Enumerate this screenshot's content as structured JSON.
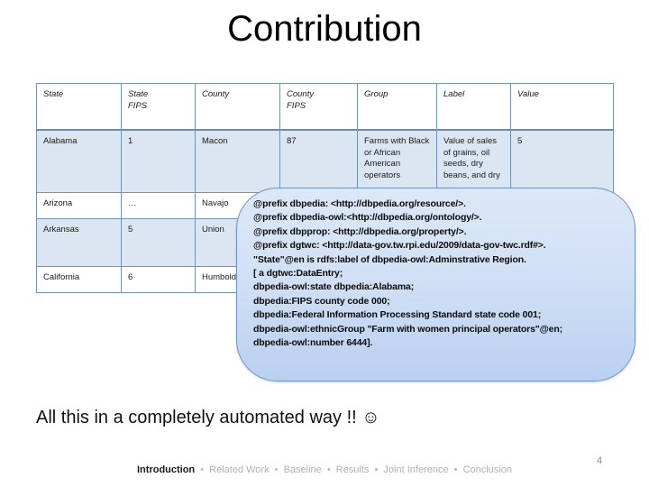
{
  "slide": {
    "title": "Contribution",
    "page_number": "4",
    "closing_line": "All this in a completely automated way !!",
    "smiley": "☺"
  },
  "table": {
    "headers": [
      {
        "line1": "State",
        "line2": ""
      },
      {
        "line1": "State",
        "line2": "FIPS"
      },
      {
        "line1": "County",
        "line2": ""
      },
      {
        "line1": "County",
        "line2": "FIPS"
      },
      {
        "line1": "Group",
        "line2": ""
      },
      {
        "line1": "Label",
        "line2": ""
      },
      {
        "line1": "Value",
        "line2": ""
      }
    ],
    "rows": [
      {
        "state": "Alabama",
        "state_fips": "1",
        "county": "Macon",
        "county_fips": "87",
        "group": "Farms with Black or African American operators",
        "label": "Value of sales of grains, oil seeds, dry beans, and dry",
        "value": "5"
      },
      {
        "state": "Arizona",
        "state_fips": "…",
        "county": "Navajo",
        "county_fips": "",
        "group": "",
        "label": "",
        "value": ""
      },
      {
        "state": "Arkansas",
        "state_fips": "5",
        "county": "Union",
        "county_fips": "",
        "group": "",
        "label": "",
        "value": ""
      },
      {
        "state": "California",
        "state_fips": "6",
        "county": "Humboldt",
        "county_fips": "",
        "group": "",
        "label": "",
        "value": ""
      }
    ]
  },
  "callout": {
    "text": "@prefix dbpedia: <http://dbpedia.org/resource/>.\n@prefix dbpedia-owl:<http://dbpedia.org/ontology/>.\n@prefix dbpprop: <http://dbpedia.org/property/>.\n@prefix dgtwc: <http://data-gov.tw.rpi.edu/2009/data-gov-twc.rdf#>.\n\"State\"@en is rdfs:label of dbpedia-owl:Adminstrative Region.\n[ a dgtwc:DataEntry;\ndbpedia-owl:state dbpedia:Alabama;\ndbpedia:FIPS county code 000;\ndbpedia:Federal Information Processing Standard state code 001;\ndbpedia-owl:ethnicGroup \"Farm with women principal operators\"@en;\ndbpedia-owl:number 6444]."
  },
  "footer": {
    "items": [
      {
        "label": "Introduction",
        "active": true
      },
      {
        "label": "Related Work",
        "active": false
      },
      {
        "label": "Baseline",
        "active": false
      },
      {
        "label": "Results",
        "active": false
      },
      {
        "label": "Joint Inference",
        "active": false
      },
      {
        "label": "Conclusion",
        "active": false
      }
    ],
    "separator": "•"
  },
  "colors": {
    "table_border": "#7293bb",
    "row_shaded": "#dce6f2",
    "callout_border": "#6f94cd",
    "footer_inactive": "#b0b0b0"
  }
}
